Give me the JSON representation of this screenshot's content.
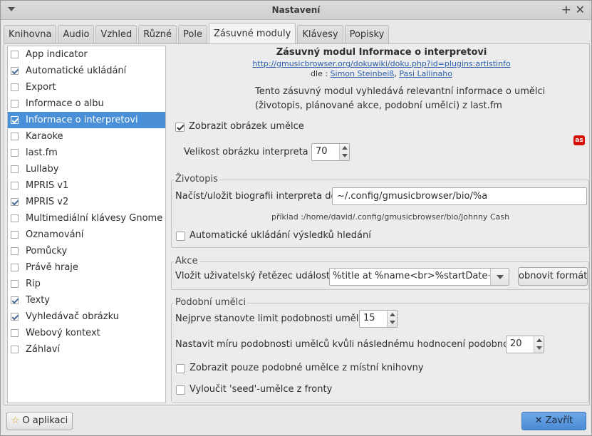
{
  "window": {
    "title": "Nastavení"
  },
  "tabs": [
    {
      "label": "Knihovna"
    },
    {
      "label": "Audio"
    },
    {
      "label": "Vzhled"
    },
    {
      "label": "Různé"
    },
    {
      "label": "Pole"
    },
    {
      "label": "Zásuvné moduly",
      "active": true
    },
    {
      "label": "Klávesy"
    },
    {
      "label": "Popisky"
    }
  ],
  "plugins": [
    {
      "label": "App indicator",
      "checked": false
    },
    {
      "label": "Automatické ukládání",
      "checked": true
    },
    {
      "label": "Export",
      "checked": false
    },
    {
      "label": "Informace o albu",
      "checked": false
    },
    {
      "label": "Informace o interpretovi",
      "checked": true,
      "selected": true
    },
    {
      "label": "Karaoke",
      "checked": false
    },
    {
      "label": "last.fm",
      "checked": false
    },
    {
      "label": "Lullaby",
      "checked": false
    },
    {
      "label": "MPRIS v1",
      "checked": false
    },
    {
      "label": "MPRIS v2",
      "checked": true
    },
    {
      "label": "Multimediální klávesy Gnome",
      "checked": false
    },
    {
      "label": "Oznamování",
      "checked": false
    },
    {
      "label": "Pomůcky",
      "checked": false
    },
    {
      "label": "Právě hraje",
      "checked": false
    },
    {
      "label": "Rip",
      "checked": false
    },
    {
      "label": "Texty",
      "checked": true
    },
    {
      "label": "Vyhledávač obrázku",
      "checked": true
    },
    {
      "label": "Webový kontext",
      "checked": false
    },
    {
      "label": "Záhlaví",
      "checked": false
    }
  ],
  "plugin_info": {
    "title": "Zásuvný modul Informace o interpretovi",
    "url": "http://gmusicbrowser.org/dokuwiki/doku.php?id=plugins:artistinfo",
    "authors_prefix": "dle : ",
    "author1": "Simon Steinbeiß",
    "author_sep": ", ",
    "author2": "Pasi Lallinaho",
    "description": "Tento zásuvný modul vyhledává relevantní informace o umělci (životopis, plánované akce, podobní umělci) z last.fm"
  },
  "general": {
    "show_picture_label": "Zobrazit obrázek umělce",
    "show_picture_checked": true,
    "picture_size_label": "Velikost obrázku interpreta :",
    "picture_size_value": "70",
    "lastfm_icon_text": "as"
  },
  "bio": {
    "section_label": "Životopis",
    "path_label": "Načíst/uložit biografii interpreta do:",
    "path_value": "~/.config/gmusicbrowser/bio/%a",
    "example": "příklad :/home/david/.config/gmusicbrowser/bio/Johnny Cash",
    "autosave_label": "Automatické ukládání výsledků hledání",
    "autosave_checked": false
  },
  "events": {
    "section_label": "Akce",
    "string_label": "Vložit uživatelský řetězec události :",
    "string_value": "%title at %name<br>%startDate<br>",
    "reset_label": "obnovit formát"
  },
  "similar": {
    "section_label": "Podobní umělci",
    "limit_label": "Nejprve stanovte limit podobnosti umělce",
    "limit_value": "15",
    "rating_label": "Nastavit míru podobnosti umělců kvůli následnému hodnocení podobnosti :",
    "rating_value": "20",
    "local_only_label": "Zobrazit pouze podobné umělce z místní knihovny",
    "local_only_checked": false,
    "exclude_seed_label": "Vyloučit 'seed'-umělce z fronty",
    "exclude_seed_checked": false
  },
  "footer": {
    "about_label": "O aplikaci",
    "close_label": "Zavřít"
  }
}
